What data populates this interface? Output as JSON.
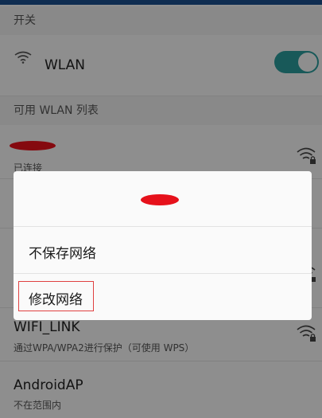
{
  "sections": {
    "switch_header": "开关",
    "list_header": "可用 WLAN 列表"
  },
  "wlan_toggle": {
    "label": "WLAN",
    "on": true
  },
  "networks": [
    {
      "name": "",
      "status": "已连接"
    },
    {
      "name": "WIFI_LINK",
      "status": "通过WPA/WPA2进行保护（可使用 WPS）"
    },
    {
      "name": "AndroidAP",
      "status": "不在范围内"
    }
  ],
  "dialog": {
    "title": "",
    "options": [
      {
        "label": "不保存网络"
      },
      {
        "label": "修改网络"
      }
    ]
  },
  "colors": {
    "toggle_on": "#2a9a9a",
    "redaction": "#e6111b",
    "highlight": "#e04040"
  },
  "icons": {
    "wlan": "wifi-icon",
    "network_signal": "wifi-lock-icon"
  }
}
